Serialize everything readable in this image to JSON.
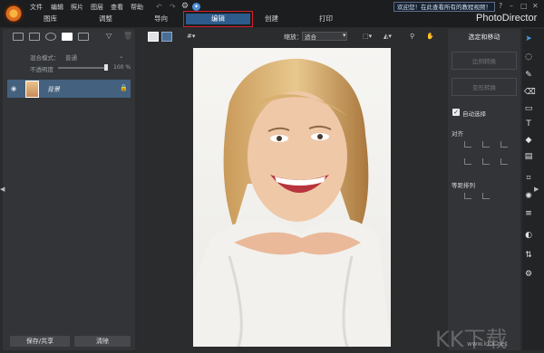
{
  "app": {
    "brand": "PhotoDirector"
  },
  "menu": [
    "文件",
    "编辑",
    "照片",
    "图层",
    "查看",
    "帮助"
  ],
  "banner": {
    "text": "欢迎您！在此查看所有的教程视频！"
  },
  "mode_tabs": [
    "图库",
    "调整",
    "导向",
    "编辑",
    "创建",
    "打印"
  ],
  "active_tab": "编辑",
  "left_panel": {
    "blend_label": "混合模式：",
    "blend_value": "普通",
    "opacity_label": "不透明度",
    "opacity_value": "100 %",
    "layer_name": "背景",
    "save_share": "保存/共享",
    "clear": "清除"
  },
  "canvas": {
    "zoom_label": "缩放：",
    "zoom_value": "适合"
  },
  "right_panel": {
    "title": "选定和移动",
    "scale_transform": "比例转换",
    "warp_transform": "变形转换",
    "auto_select": "自动选择",
    "align": "对齐",
    "distribute": "等距排列"
  },
  "watermark": {
    "text": "KK下载",
    "url": "www.kkx.net"
  },
  "colors": {
    "accent": "#2d5b8b",
    "highlight_border": "#d4202a"
  }
}
